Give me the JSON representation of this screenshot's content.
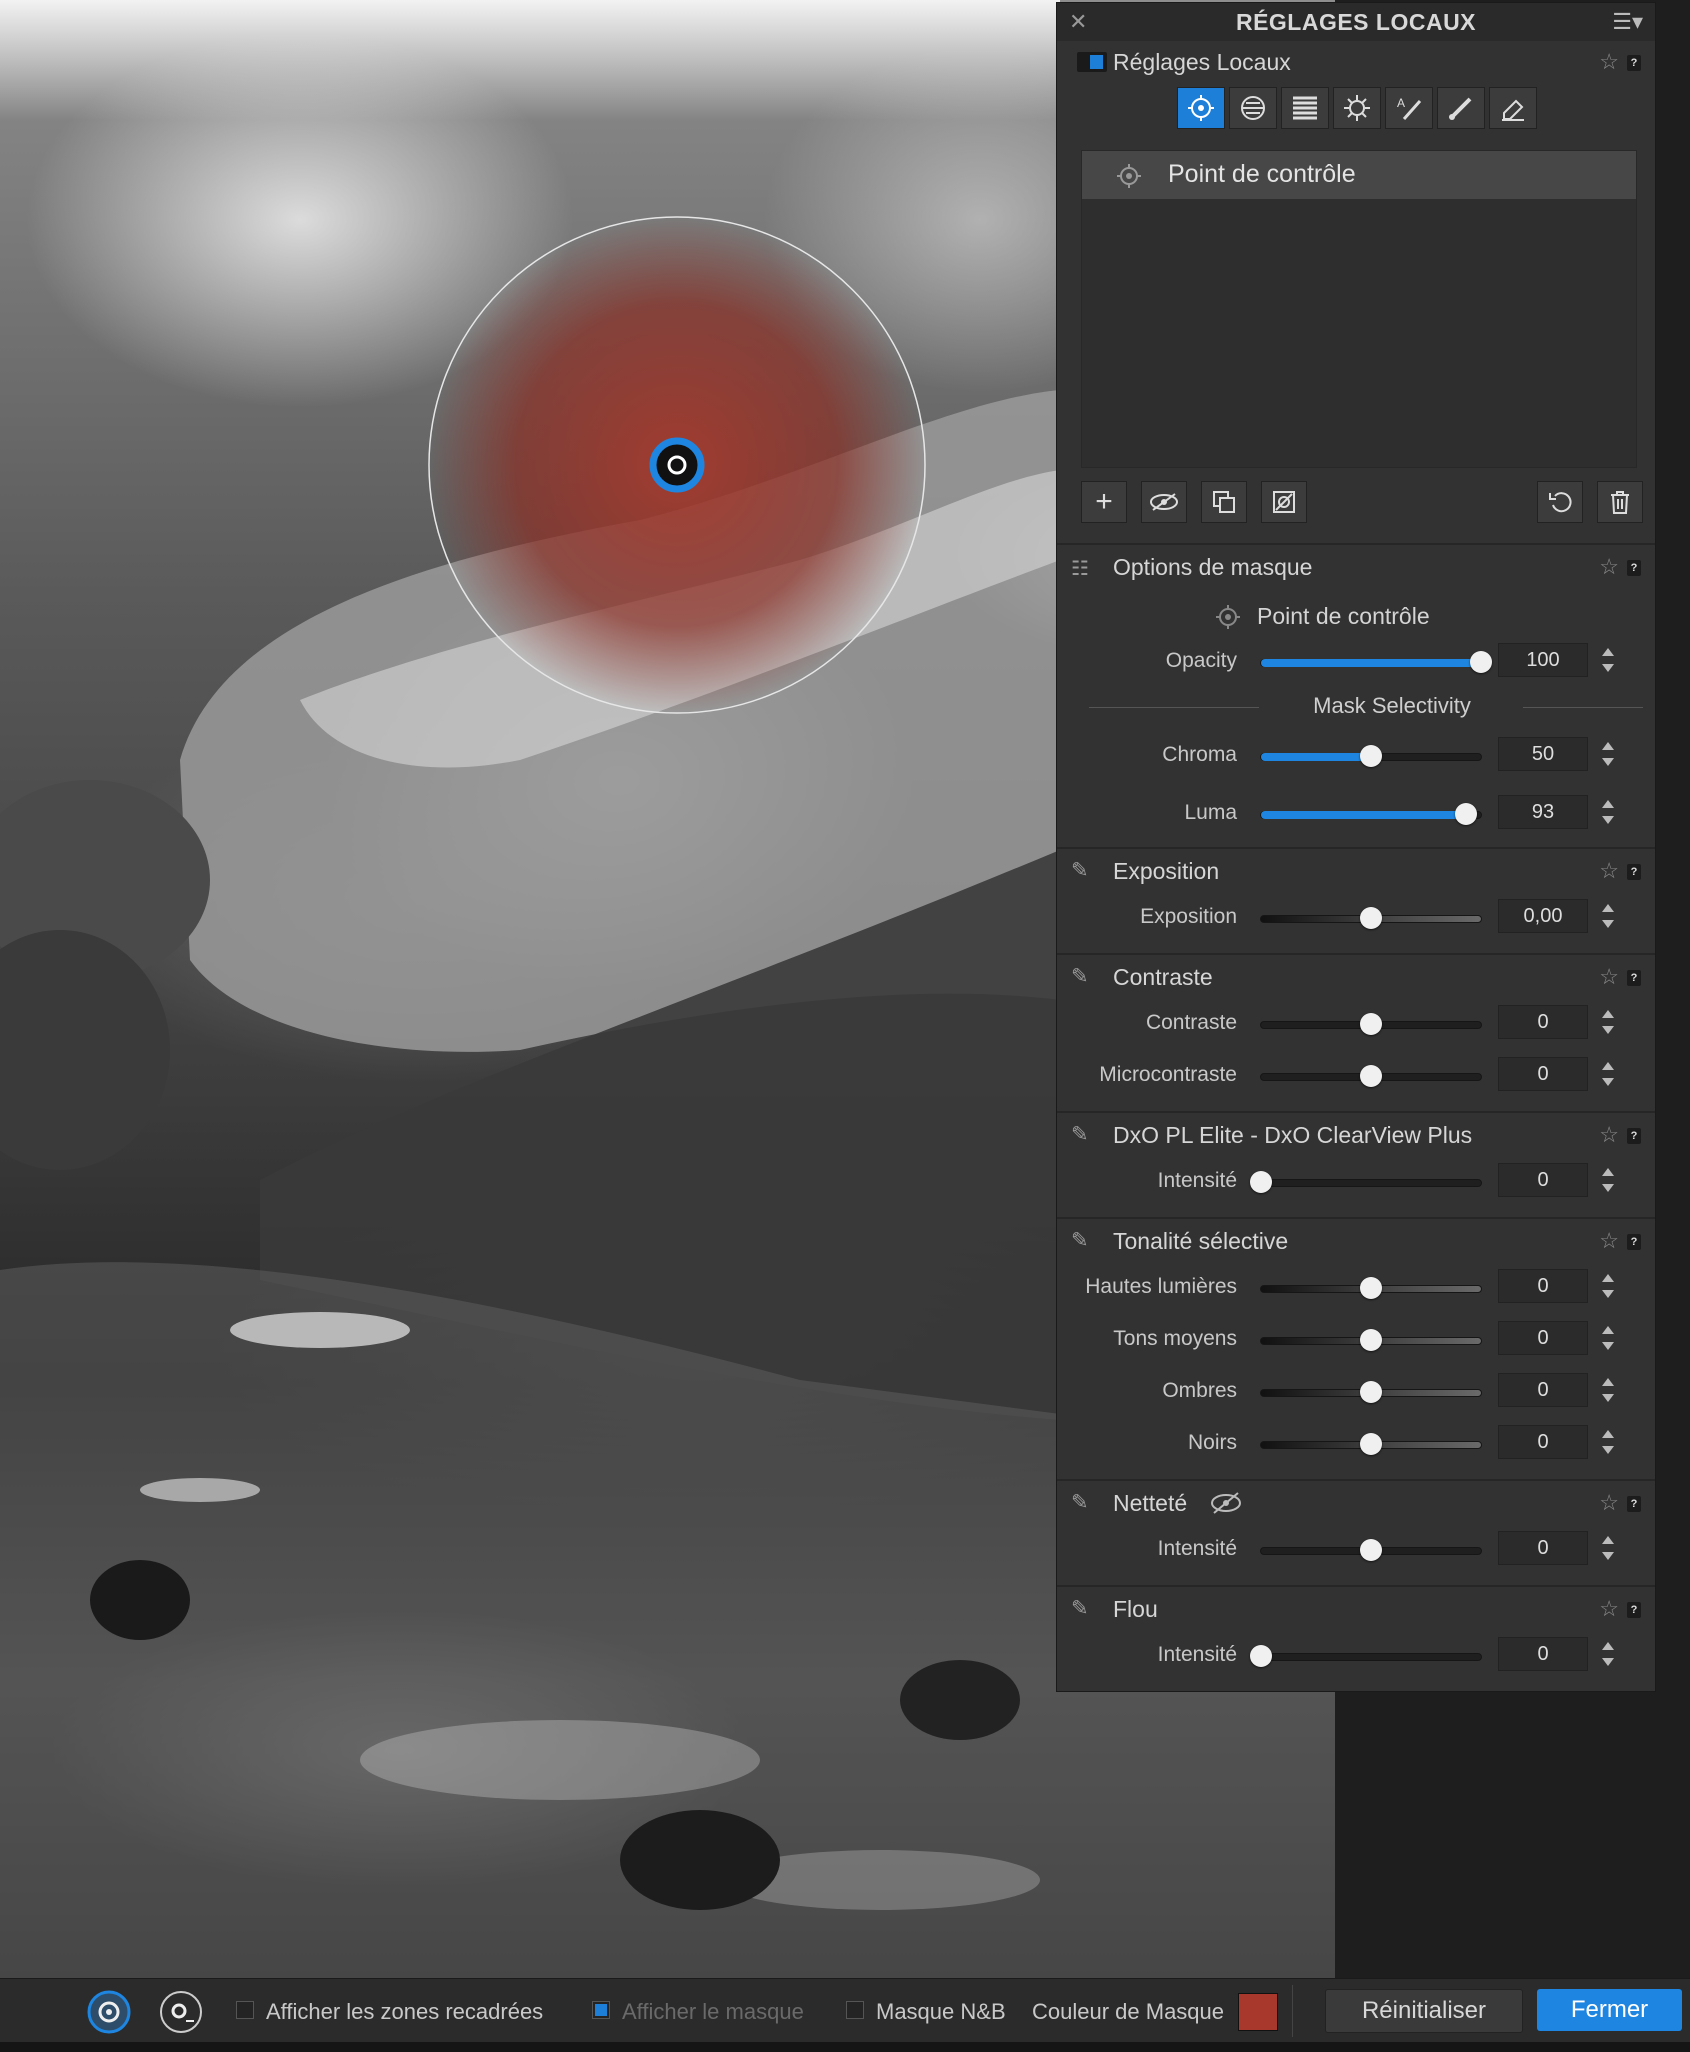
{
  "panel": {
    "title": "RÉGLAGES LOCAUX",
    "header_label": "Réglages Locaux",
    "tools": [
      "control-point-icon",
      "brush-stroke-icon",
      "graduated-filter-icon",
      "auto-mask-icon",
      "text-tool-icon",
      "brush-icon",
      "eraser-icon"
    ],
    "list_item": "Point de contrôle",
    "mask_options": {
      "title": "Options de masque",
      "type_label": "Point de contrôle",
      "opacity_label": "Opacity",
      "opacity_value": "100",
      "opacity_level": 100,
      "selectivity_title": "Mask Selectivity",
      "chroma_label": "Chroma",
      "chroma_value": "50",
      "chroma_level": 50,
      "luma_label": "Luma",
      "luma_value": "93",
      "luma_level": 93
    },
    "exposition": {
      "title": "Exposition",
      "param": "Exposition",
      "value": "0,00",
      "level": 50
    },
    "contraste": {
      "title": "Contraste",
      "params": [
        {
          "label": "Contraste",
          "value": "0",
          "level": 50
        },
        {
          "label": "Microcontraste",
          "value": "0",
          "level": 50
        }
      ]
    },
    "clearview": {
      "title": "DxO PL Elite - DxO ClearView Plus",
      "param": "Intensité",
      "value": "0",
      "level": 0
    },
    "tonalite": {
      "title": "Tonalité sélective",
      "params": [
        {
          "label": "Hautes lumières",
          "value": "0",
          "level": 50
        },
        {
          "label": "Tons moyens",
          "value": "0",
          "level": 50
        },
        {
          "label": "Ombres",
          "value": "0",
          "level": 50
        },
        {
          "label": "Noirs",
          "value": "0",
          "level": 50
        }
      ]
    },
    "nettete": {
      "title": "Netteté",
      "param": "Intensité",
      "value": "0",
      "level": 50
    },
    "flou": {
      "title": "Flou",
      "param": "Intensité",
      "value": "0",
      "level": 0
    }
  },
  "bottom": {
    "crop_zones_label": "Afficher les zones recadrées",
    "show_mask_label": "Afficher le masque",
    "bw_mask_label": "Masque N&B",
    "mask_color_label": "Couleur de Masque",
    "mask_color": "#a8382b",
    "reset_label": "Réinitialiser",
    "close_label": "Fermer"
  },
  "help": "?",
  "colors": {
    "accent": "#1e7fd8",
    "mask_red": "#a8382b"
  }
}
